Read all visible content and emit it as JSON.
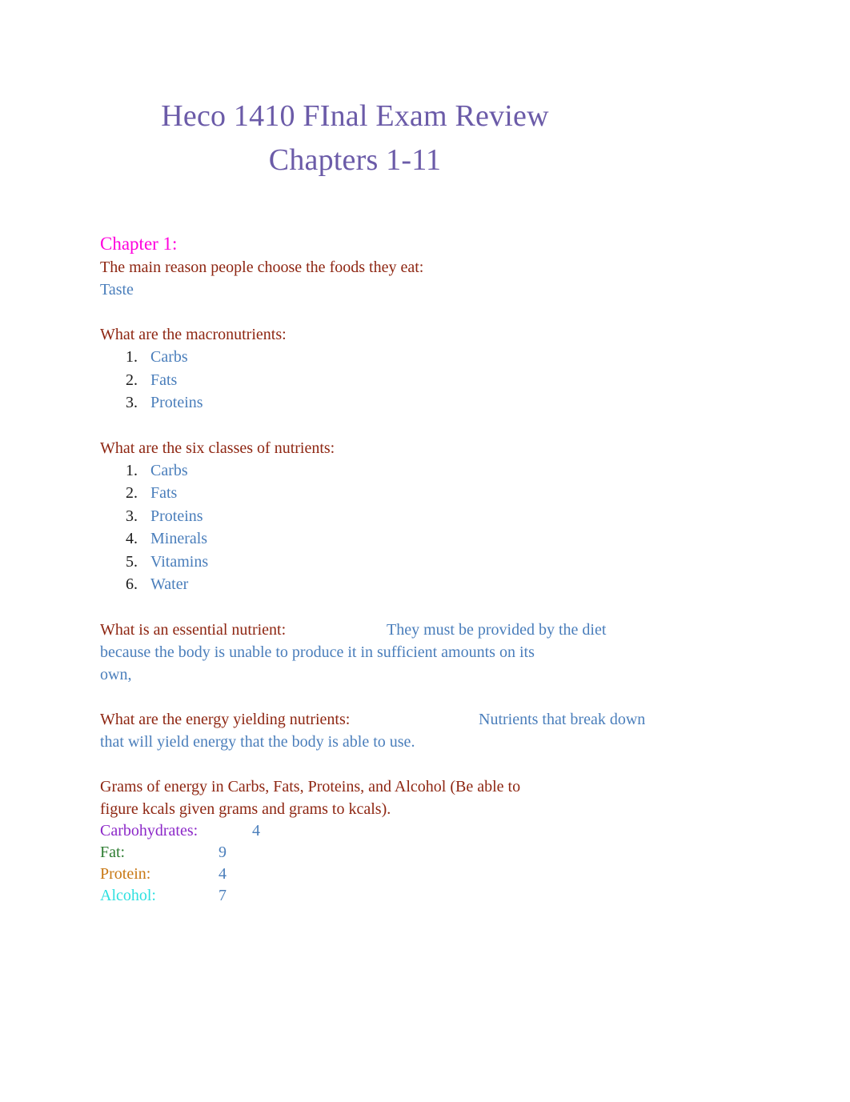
{
  "document": {
    "title_lines": [
      "Heco 1410 FInal Exam Review",
      "Chapters 1-11"
    ],
    "title_color": "#6b5ba8"
  },
  "colors": {
    "title": "#6b5ba8",
    "chapter_heading": "#ff00dd",
    "question": "#8e2612",
    "answer": "#4a7ebb",
    "list_marker": "#1a1a1a",
    "carbohydrates_label": "#8c28c8",
    "fat_label": "#2e7d32",
    "protein_label": "#c87814",
    "alcohol_label": "#2ee0e0"
  },
  "chapter": {
    "heading": "Chapter 1:"
  },
  "sections": {
    "main_reason": {
      "question": "The main reason people choose the foods they eat:",
      "answer": "Taste"
    },
    "macronutrients": {
      "question": "What are the macronutrients:",
      "items": [
        {
          "marker": "1.",
          "text": "Carbs"
        },
        {
          "marker": "2.",
          "text": "Fats"
        },
        {
          "marker": "3.",
          "text": "Proteins"
        }
      ]
    },
    "six_classes": {
      "question": "What are the six classes of nutrients:",
      "items": [
        {
          "marker": "1.",
          "text": "Carbs"
        },
        {
          "marker": "2.",
          "text": "Fats"
        },
        {
          "marker": "3.",
          "text": "Proteins"
        },
        {
          "marker": "4.",
          "text": "Minerals"
        },
        {
          "marker": "5.",
          "text": "Vitamins"
        },
        {
          "marker": "6.",
          "text": "Water"
        }
      ]
    },
    "essential_nutrient": {
      "question": "What is an essential nutrient:",
      "answer_line1": "They must be provided by the diet",
      "answer_line2": "because the body is unable to produce it in sufficient amounts on its",
      "answer_line3": "own,"
    },
    "energy_yielding": {
      "question": "What are the energy yielding nutrients:",
      "answer_line1": "Nutrients that break down",
      "answer_line2": "that will yield energy that the body is able to use."
    },
    "grams_of_energy": {
      "question_line1": " Grams of energy in Carbs, Fats, Proteins, and Alcohol (Be able to",
      "question_line2": "figure kcals given grams and grams to kcals).",
      "rows": [
        {
          "label": "Carbohydrates:",
          "value": "4"
        },
        {
          "label": "Fat:",
          "value": "9"
        },
        {
          "label": "Protein:",
          "value": "4"
        },
        {
          "label": "Alcohol:",
          "value": "7"
        }
      ]
    }
  }
}
